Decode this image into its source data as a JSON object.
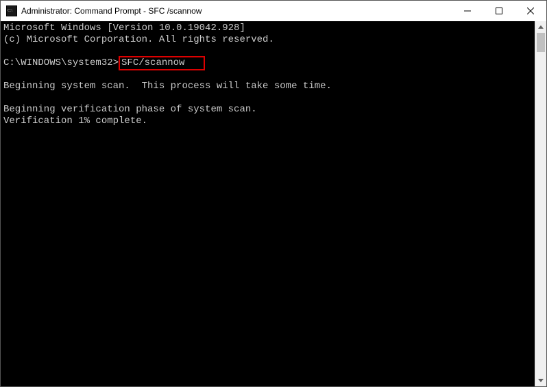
{
  "titlebar": {
    "title": "Administrator: Command Prompt - SFC /scannow"
  },
  "console": {
    "line_version": "Microsoft Windows [Version 10.0.19042.928]",
    "line_copyright": "(c) Microsoft Corporation. All rights reserved.",
    "prompt": "C:\\WINDOWS\\system32>",
    "command": "SFC/scannow",
    "line_beginning_scan": "Beginning system scan.  This process will take some time.",
    "line_beginning_verify": "Beginning verification phase of system scan.",
    "line_verification": "Verification 1% complete."
  },
  "watermark": ""
}
